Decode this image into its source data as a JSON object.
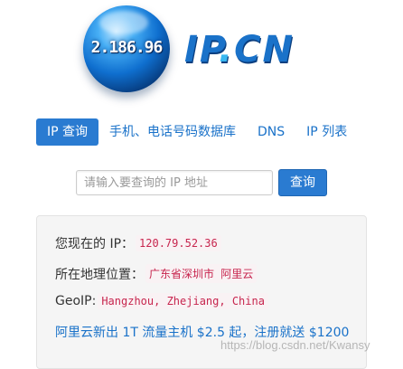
{
  "logo": {
    "globe_text": "2.186.96",
    "brand_left": "IP",
    "brand_dot": ".",
    "brand_right": "CN"
  },
  "nav": {
    "items": [
      {
        "label": "IP 查询",
        "active": true
      },
      {
        "label": "手机、电话号码数据库",
        "active": false
      },
      {
        "label": "DNS",
        "active": false
      },
      {
        "label": "IP 列表",
        "active": false
      }
    ]
  },
  "search": {
    "placeholder": "请输入要查询的 IP 地址",
    "value": "",
    "button_label": "查询"
  },
  "info": {
    "ip_label": "您现在的 IP：",
    "ip_value": "120.79.52.36",
    "location_label": "所在地理位置：",
    "location_value": "广东省深圳市 阿里云",
    "geoip_label": "GeoIP:",
    "geoip_value": "Hangzhou, Zhejiang, China",
    "promo_text": "阿里云新出 1T 流量主机 $2.5 起，注册就送 $1200"
  },
  "watermark": "https://blog.csdn.net/Kwansy",
  "colors": {
    "primary": "#2a7bd1",
    "link": "#1a72c9",
    "code_text": "#c7254e",
    "code_bg": "#f9f2f4",
    "panel_bg": "#f5f5f5"
  }
}
